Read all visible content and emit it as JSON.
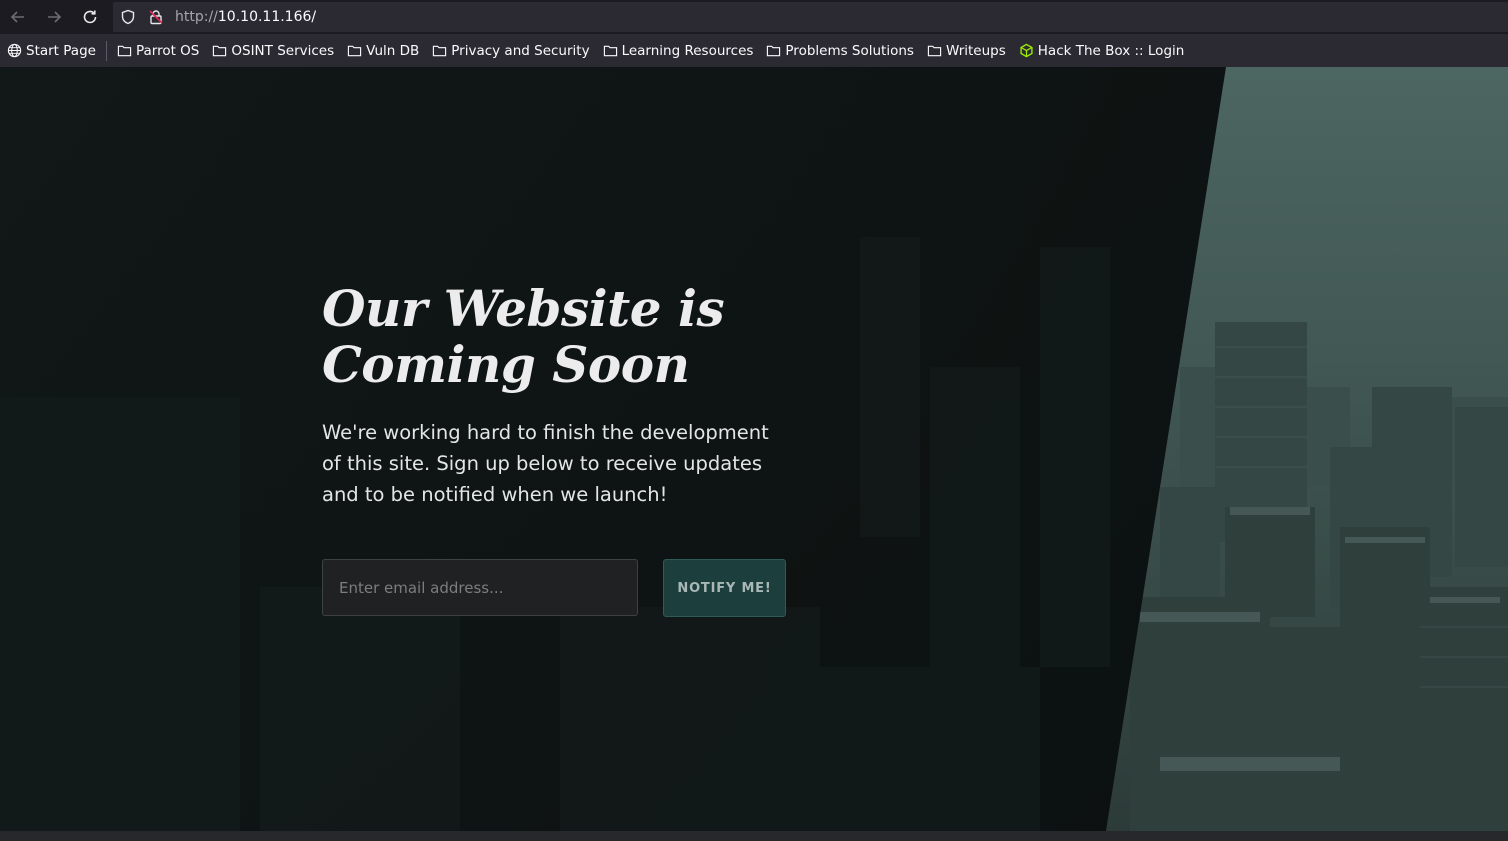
{
  "browser": {
    "url_protocol": "http://",
    "url_host": "10.10.11.166/",
    "icons": [
      "back-icon",
      "forward-icon",
      "reload-icon",
      "shield-icon",
      "insecure-lock-icon"
    ]
  },
  "bookmarks": [
    {
      "label": "Start Page",
      "icon": "globe-icon"
    },
    {
      "label": "Parrot OS",
      "icon": "folder-icon"
    },
    {
      "label": "OSINT Services",
      "icon": "folder-icon"
    },
    {
      "label": "Vuln DB",
      "icon": "folder-icon"
    },
    {
      "label": "Privacy and Security",
      "icon": "folder-icon"
    },
    {
      "label": "Learning Resources",
      "icon": "folder-icon"
    },
    {
      "label": "Problems Solutions",
      "icon": "folder-icon"
    },
    {
      "label": "Writeups",
      "icon": "folder-icon"
    },
    {
      "label": "Hack The Box :: Login",
      "icon": "htb-cube-icon"
    }
  ],
  "page": {
    "headline_line1": "Our Website is",
    "headline_line2": "Coming Soon",
    "subtext": "We're working hard to finish the development of this site. Sign up below to receive updates and to be notified when we launch!",
    "email_placeholder": "Enter email address...",
    "email_value": "",
    "notify_label": "NOTIFY ME!"
  },
  "colors": {
    "accent_button": "#1c3f3d",
    "bookmark_htb": "#9fef00"
  }
}
